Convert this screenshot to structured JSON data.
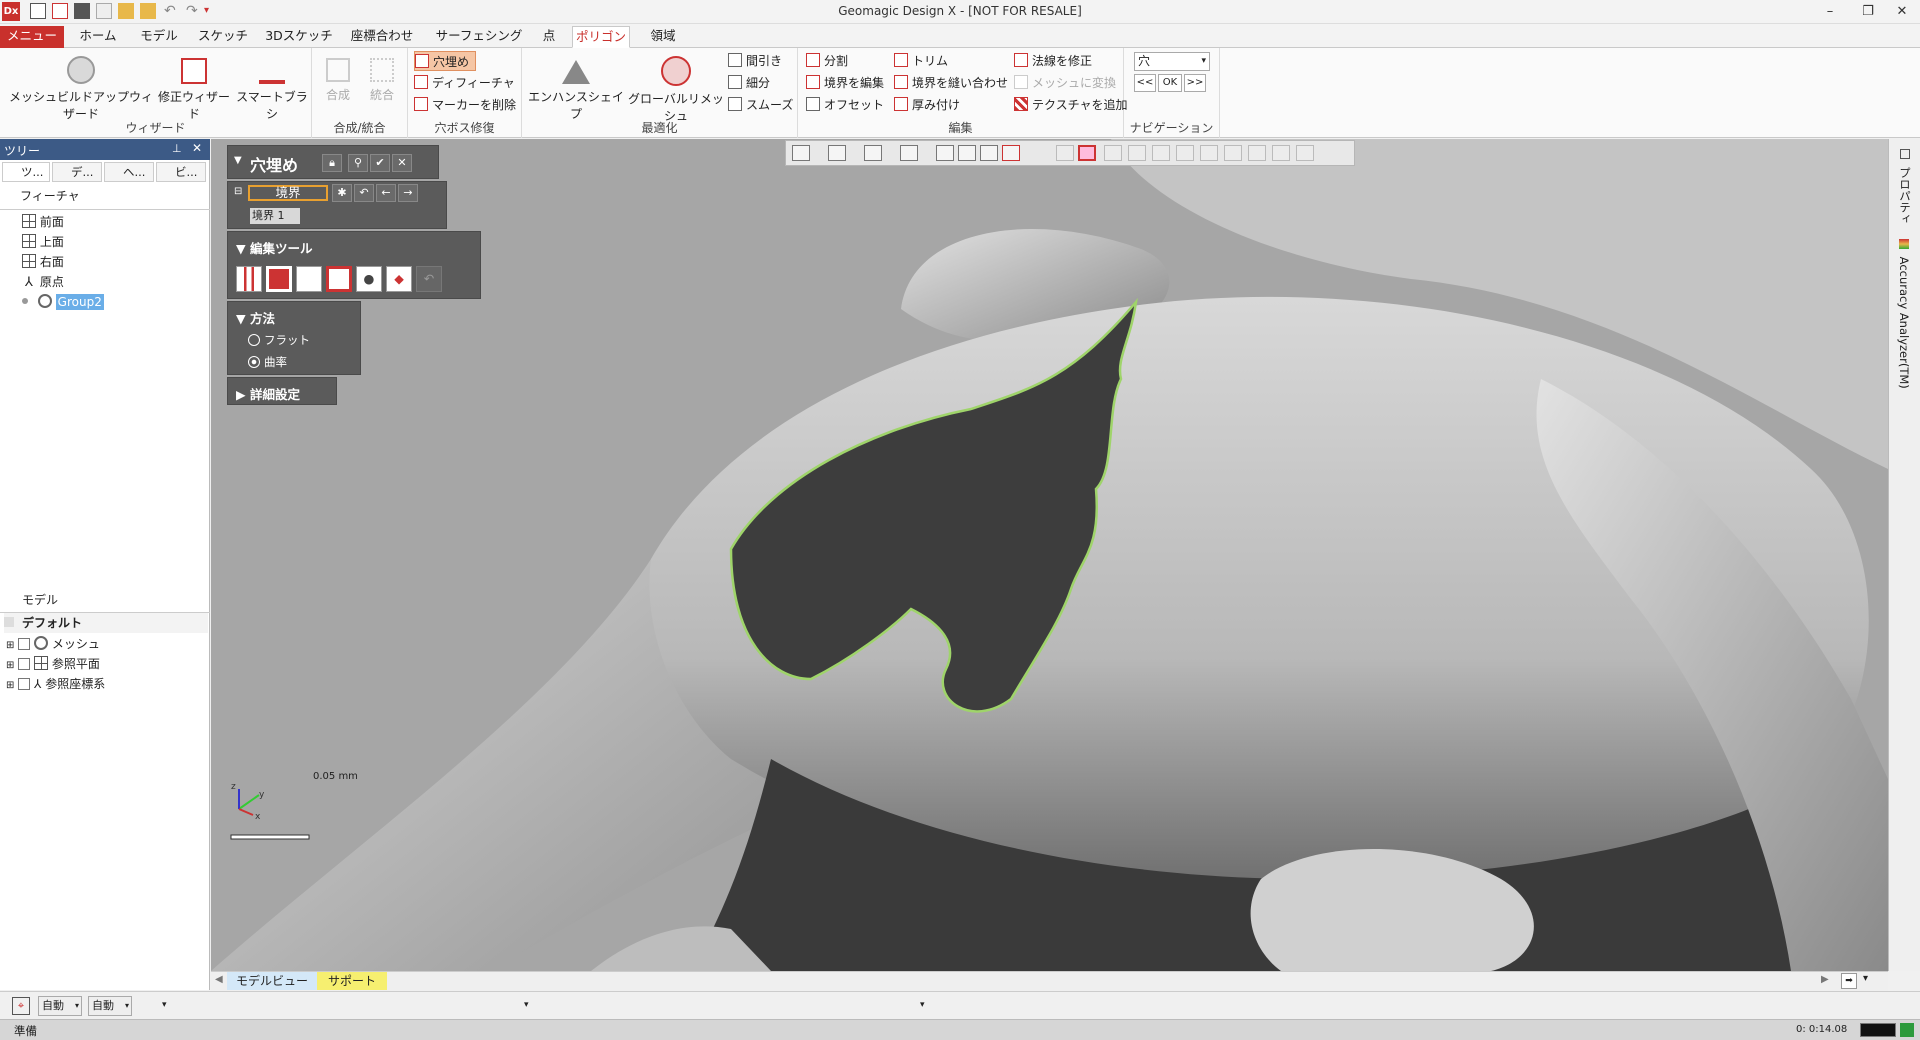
{
  "app": {
    "title": "Geomagic Design X - [NOT FOR RESALE]",
    "logo": "Dx"
  },
  "tabs": [
    "メニュー",
    "ホーム",
    "モデル",
    "スケッチ",
    "3Dスケッチ",
    "座標合わせ",
    "サーフェシング",
    "点",
    "ポリゴン",
    "領域"
  ],
  "active_tab": "ポリゴン",
  "ribbon": {
    "wizard": {
      "label": "ウィザード",
      "buttons": [
        "メッシュビルドアップウィザード",
        "修正ウィザード",
        "スマートブラシ"
      ]
    },
    "merge": {
      "label": "合成/統合",
      "buttons": [
        "合成",
        "統合"
      ]
    },
    "hole": {
      "label": "穴ボス修復",
      "buttons": [
        "穴埋め",
        "ディフィーチャ",
        "マーカーを削除"
      ]
    },
    "optimize": {
      "label": "最適化",
      "big": [
        "エンハンスシェイプ",
        "グローバルリメッシュ"
      ],
      "small": [
        "間引き",
        "細分",
        "スムーズ"
      ]
    },
    "edit": {
      "label": "編集",
      "col1": [
        "分割",
        "境界を編集",
        "オフセット"
      ],
      "col2": [
        "トリム",
        "境界を縫い合わせ",
        "厚み付け"
      ],
      "col3": [
        "法線を修正",
        "メッシュに変換",
        "テクスチャを追加"
      ]
    },
    "nav": {
      "label": "ナビゲーション",
      "combo": "穴",
      "prev": "<<",
      "ok": "OK",
      "next": ">>"
    }
  },
  "left_panel": {
    "title": "ツリー",
    "tabs": [
      "ツ...",
      "デ...",
      "ヘ...",
      "ビ..."
    ],
    "feature_header": "フィーチャ",
    "features": [
      "前面",
      "上面",
      "右面",
      "原点",
      "Group2"
    ],
    "model_header": "モデル",
    "model_default": "デフォルト",
    "model_items": [
      "メッシュ",
      "参照平面",
      "参照座標系"
    ]
  },
  "dialog": {
    "title": "穴埋め",
    "boundary_field": "境界",
    "boundary_item": "境界 1",
    "edit_tools_header": "編集ツール",
    "method_header": "方法",
    "method_options": [
      "フラット",
      "曲率"
    ],
    "method_selected": "曲率",
    "advanced_header": "詳細設定"
  },
  "viewport": {
    "scale_label": "0.05 mm",
    "axes": [
      "x",
      "y",
      "z"
    ]
  },
  "right_panel": {
    "tabs": [
      "プロパティ",
      "Accuracy Analyzer(TM)"
    ]
  },
  "bottom_tabs": [
    "モデルビュー",
    "サポート"
  ],
  "status_row": {
    "combo1": "自動",
    "combo2": "自動"
  },
  "statusbar": {
    "left": "準備",
    "time": "0: 0:14.08"
  },
  "colors": {
    "accent": "#c9302c",
    "selection_outline": "#9fd46a",
    "panel_bg": "#5b5b5b",
    "model_gray": "#c9c9c9"
  }
}
